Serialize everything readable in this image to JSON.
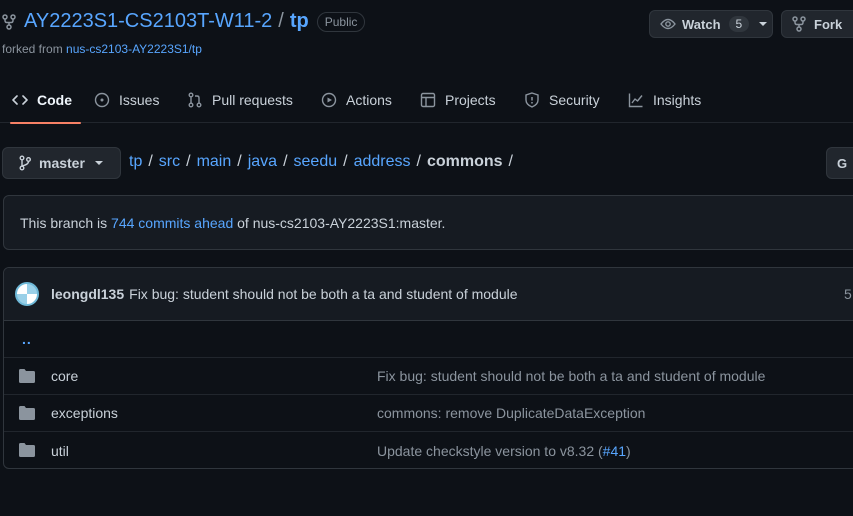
{
  "repo": {
    "owner": "AY2223S1-CS2103T-W11-2",
    "separator": "/",
    "name": "tp",
    "visibility": "Public",
    "forked_prefix": "forked from ",
    "forked_from": "nus-cs2103-AY2223S1/tp"
  },
  "actions": {
    "watch_label": "Watch",
    "watch_count": "5",
    "fork_label": "Fork"
  },
  "tabs": [
    {
      "label": "Code",
      "icon": "code-icon",
      "active": true
    },
    {
      "label": "Issues",
      "icon": "issue-opened-icon"
    },
    {
      "label": "Pull requests",
      "icon": "git-pull-request-icon"
    },
    {
      "label": "Actions",
      "icon": "play-icon"
    },
    {
      "label": "Projects",
      "icon": "table-icon"
    },
    {
      "label": "Security",
      "icon": "shield-icon"
    },
    {
      "label": "Insights",
      "icon": "graph-icon"
    }
  ],
  "branch": {
    "name": "master"
  },
  "breadcrumb": {
    "parts": [
      "tp",
      "src",
      "main",
      "java",
      "seedu",
      "address"
    ],
    "current": "commons",
    "trailing": "/"
  },
  "goto_label": "G",
  "ahead": {
    "prefix": "This branch is ",
    "link": "744 commits ahead",
    "suffix": " of nus-cs2103-AY2223S1:master."
  },
  "latest_commit": {
    "author": "leongdl135",
    "message": "Fix bug: student should not be both a ta and student of module",
    "age": "5"
  },
  "parent_dir": "..",
  "files": [
    {
      "name": "core",
      "message": "Fix bug: student should not be both a ta and student of module"
    },
    {
      "name": "exceptions",
      "message": "commons: remove DuplicateDataException"
    },
    {
      "name": "util",
      "message_prefix": "Update checkstyle version to v8.32 (",
      "message_link": "#41",
      "message_suffix": ")"
    }
  ],
  "colors": {
    "background": "#0d1117",
    "link": "#58a6ff",
    "active_tab_underline": "#f78166",
    "muted": "#8b949e"
  }
}
